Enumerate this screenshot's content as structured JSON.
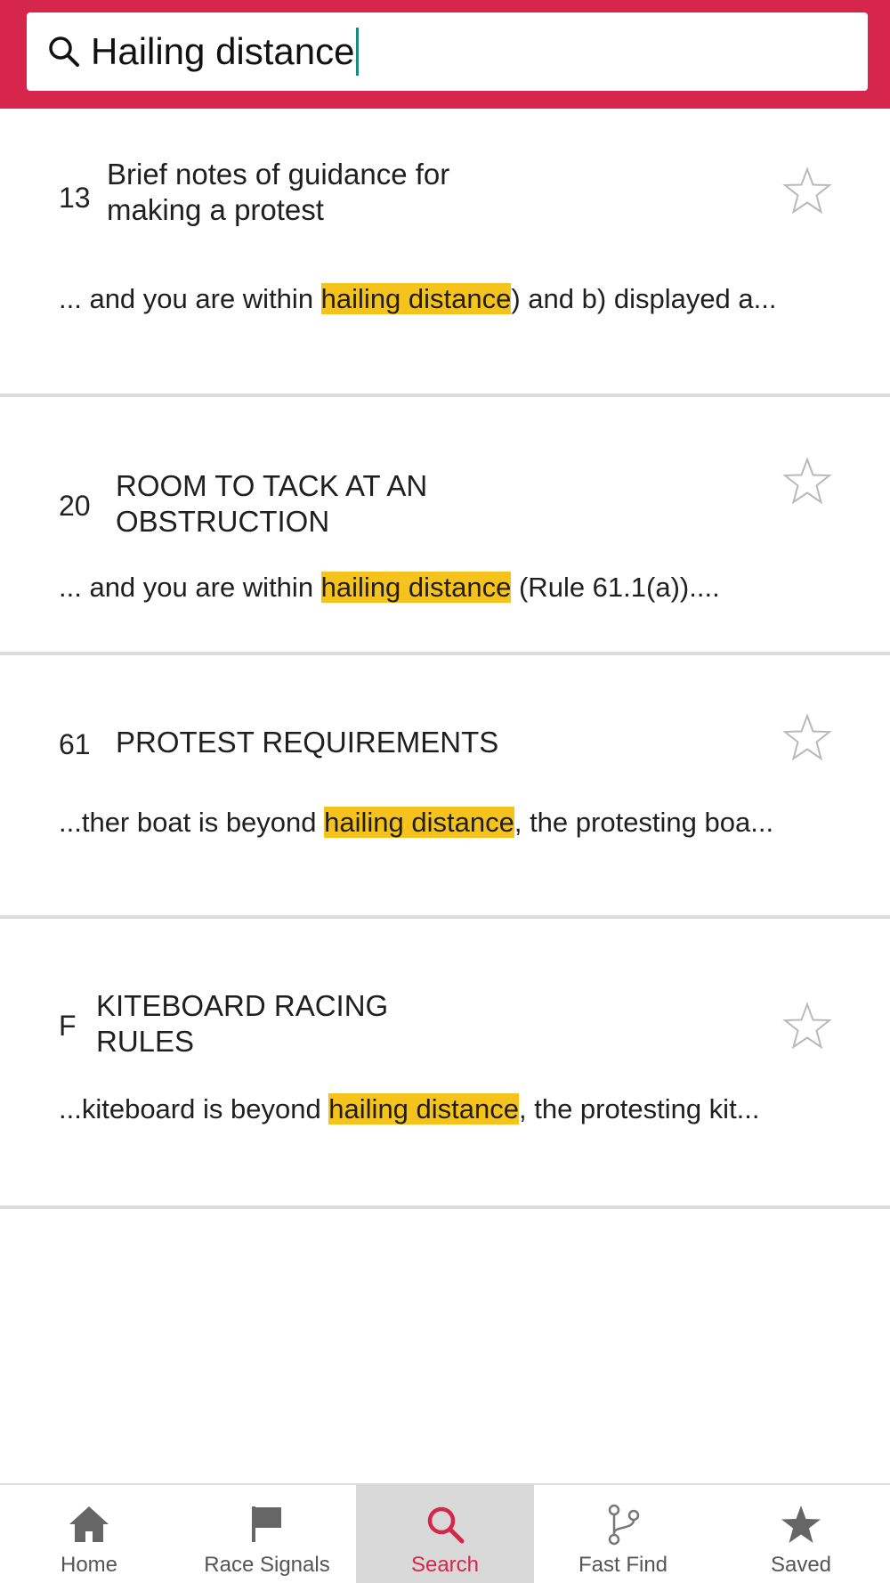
{
  "search": {
    "query": "Hailing distance"
  },
  "results": [
    {
      "number": "13",
      "title": "Brief notes of guidance for making a protest",
      "snippet_before": "... and you are within ",
      "snippet_match": "hailing distance",
      "snippet_after": ") and b) displayed a..."
    },
    {
      "number": "20",
      "title": "ROOM TO TACK AT AN OBSTRUCTION",
      "snippet_before": "... and you are within ",
      "snippet_match": "hailing distance",
      "snippet_after": " (Rule 61.1(a))...."
    },
    {
      "number": "61",
      "title": "PROTEST REQUIREMENTS",
      "snippet_before": "...ther boat is beyond ",
      "snippet_match": "hailing distance",
      "snippet_after": ", the protesting boa..."
    },
    {
      "number": "F",
      "title": "KITEBOARD RACING RULES",
      "snippet_before": "...kiteboard is beyond ",
      "snippet_match": "hailing distance",
      "snippet_after": ", the protesting kit..."
    }
  ],
  "tabs": [
    {
      "label": "Home",
      "icon": "home-icon"
    },
    {
      "label": "Race Signals",
      "icon": "flag-icon"
    },
    {
      "label": "Search",
      "icon": "search-icon"
    },
    {
      "label": "Fast Find",
      "icon": "branch-icon"
    },
    {
      "label": "Saved",
      "icon": "star-icon"
    }
  ],
  "active_tab": "Search",
  "colors": {
    "brand": "#d7264c",
    "highlight": "#f6c21c",
    "caret": "#1a8a7a",
    "active_tab_bg": "#d9d9d9"
  }
}
